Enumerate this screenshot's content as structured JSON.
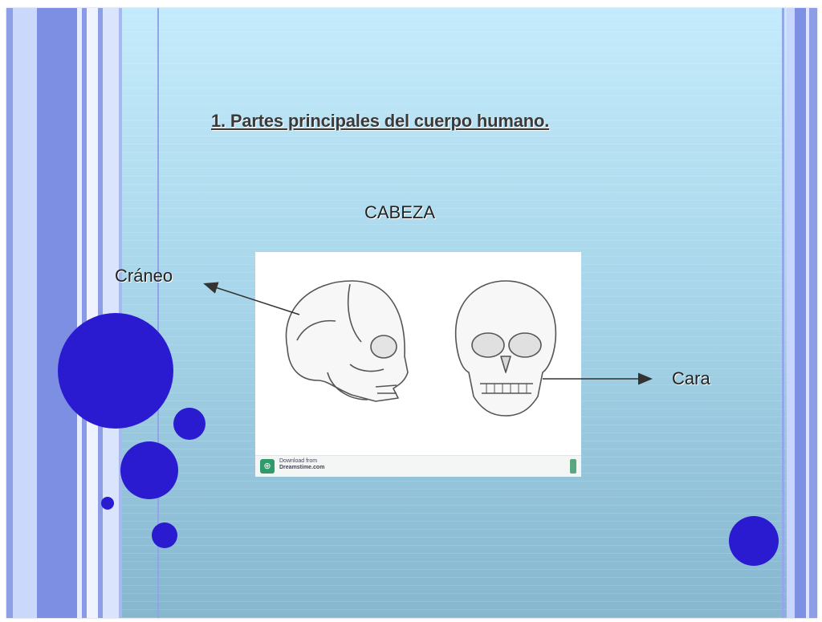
{
  "slide": {
    "title": "1. Partes principales del cuerpo humano.",
    "subtitle": "CABEZA",
    "labels": {
      "skull": "Cráneo",
      "face": "Cara"
    },
    "image": {
      "watermark_line1": "Download from",
      "watermark_line2": "Dreamstime.com"
    }
  },
  "colors": {
    "circle": "#2a1bd0",
    "stripe_dark": "#7d8fe3",
    "stripe_light": "#c6d6fb",
    "background_top": "#c4ebfb",
    "background_bottom": "#86b7cf"
  }
}
